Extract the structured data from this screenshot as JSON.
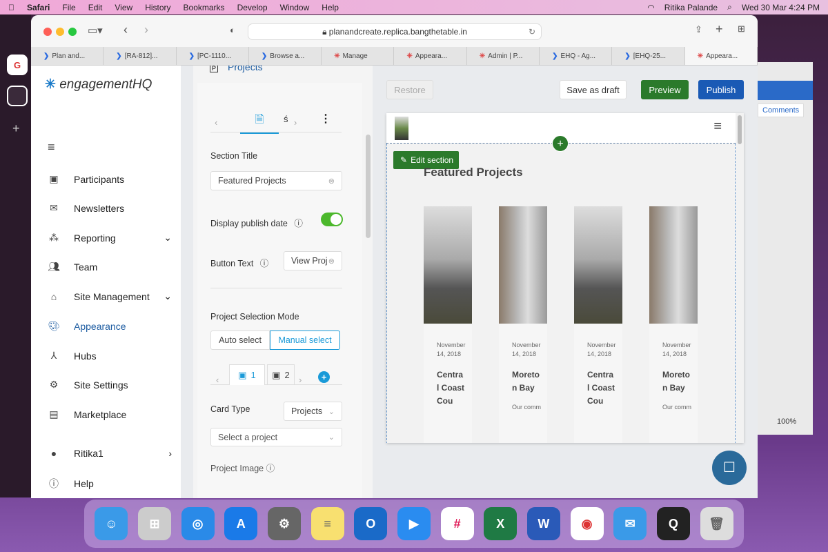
{
  "menubar": {
    "apple": "",
    "app": "Safari",
    "items": [
      "File",
      "Edit",
      "View",
      "History",
      "Bookmarks",
      "Develop",
      "Window",
      "Help"
    ],
    "user": "Ritika Palande",
    "datetime": "Wed 30 Mar  4:24 PM"
  },
  "browser": {
    "url": "planandcreate.replica.bangthetable.in",
    "tabs": [
      "Plan and...",
      "[RA-812]...",
      "[PC-1110...",
      "Browse a...",
      "Manage",
      "Appeara...",
      "Admin | P...",
      "EHQ - Ag...",
      "[EHQ-25...",
      "Appeara..."
    ],
    "active_tab": 9
  },
  "sidebar": {
    "logo": "engagementHQ",
    "items": [
      {
        "label": "Participants",
        "icon": "participants-icon"
      },
      {
        "label": "Newsletters",
        "icon": "mail-icon"
      },
      {
        "label": "Reporting",
        "icon": "reporting-icon",
        "chevron": "down"
      },
      {
        "label": "Team",
        "icon": "team-icon"
      },
      {
        "label": "Site Management",
        "icon": "home-icon",
        "chevron": "down"
      },
      {
        "label": "Appearance",
        "icon": "palette-icon",
        "active": true
      },
      {
        "label": "Hubs",
        "icon": "hubs-icon"
      },
      {
        "label": "Site Settings",
        "icon": "gear-icon"
      },
      {
        "label": "Marketplace",
        "icon": "store-icon"
      },
      {
        "label": "Ritika1",
        "icon": "user-icon",
        "chevron": "right"
      },
      {
        "label": "Help",
        "icon": "help-icon"
      }
    ]
  },
  "panel": {
    "header": "Projects",
    "section_title_label": "Section Title",
    "section_title_value": "Featured Projects",
    "display_publish_date_label": "Display publish date",
    "display_publish_date": true,
    "button_text_label": "Button Text",
    "button_text_value": "View Proj",
    "selection_mode_label": "Project Selection Mode",
    "modes": [
      "Auto select",
      "Manual select"
    ],
    "selected_mode": "Manual select",
    "card_tabs": [
      "1",
      "2"
    ],
    "card_type_label": "Card Type",
    "card_type_value": "Projects",
    "select_project_placeholder": "Select a project",
    "project_image_label": "Project Image"
  },
  "toolbar": {
    "restore": "Restore",
    "save_draft": "Save as draft",
    "preview": "Preview",
    "publish": "Publish"
  },
  "preview": {
    "edit_section": "Edit section",
    "heading": "Featured Projects",
    "cards": [
      {
        "date": "November 14, 2018",
        "title": "Central Coast Cou",
        "desc": ""
      },
      {
        "date": "November 14, 2018",
        "title": "Moreton Bay",
        "desc": "Our comm"
      },
      {
        "date": "November 14, 2018",
        "title": "Central Coast Cou",
        "desc": ""
      },
      {
        "date": "November 14, 2018",
        "title": "Moreton Bay",
        "desc": "Our comm"
      }
    ]
  },
  "right_window": {
    "comments": "Comments",
    "zoom": "100%"
  },
  "colors": {
    "green": "#2b7a2b",
    "blue": "#1a5ab5",
    "accent": "#1a9ad8"
  }
}
